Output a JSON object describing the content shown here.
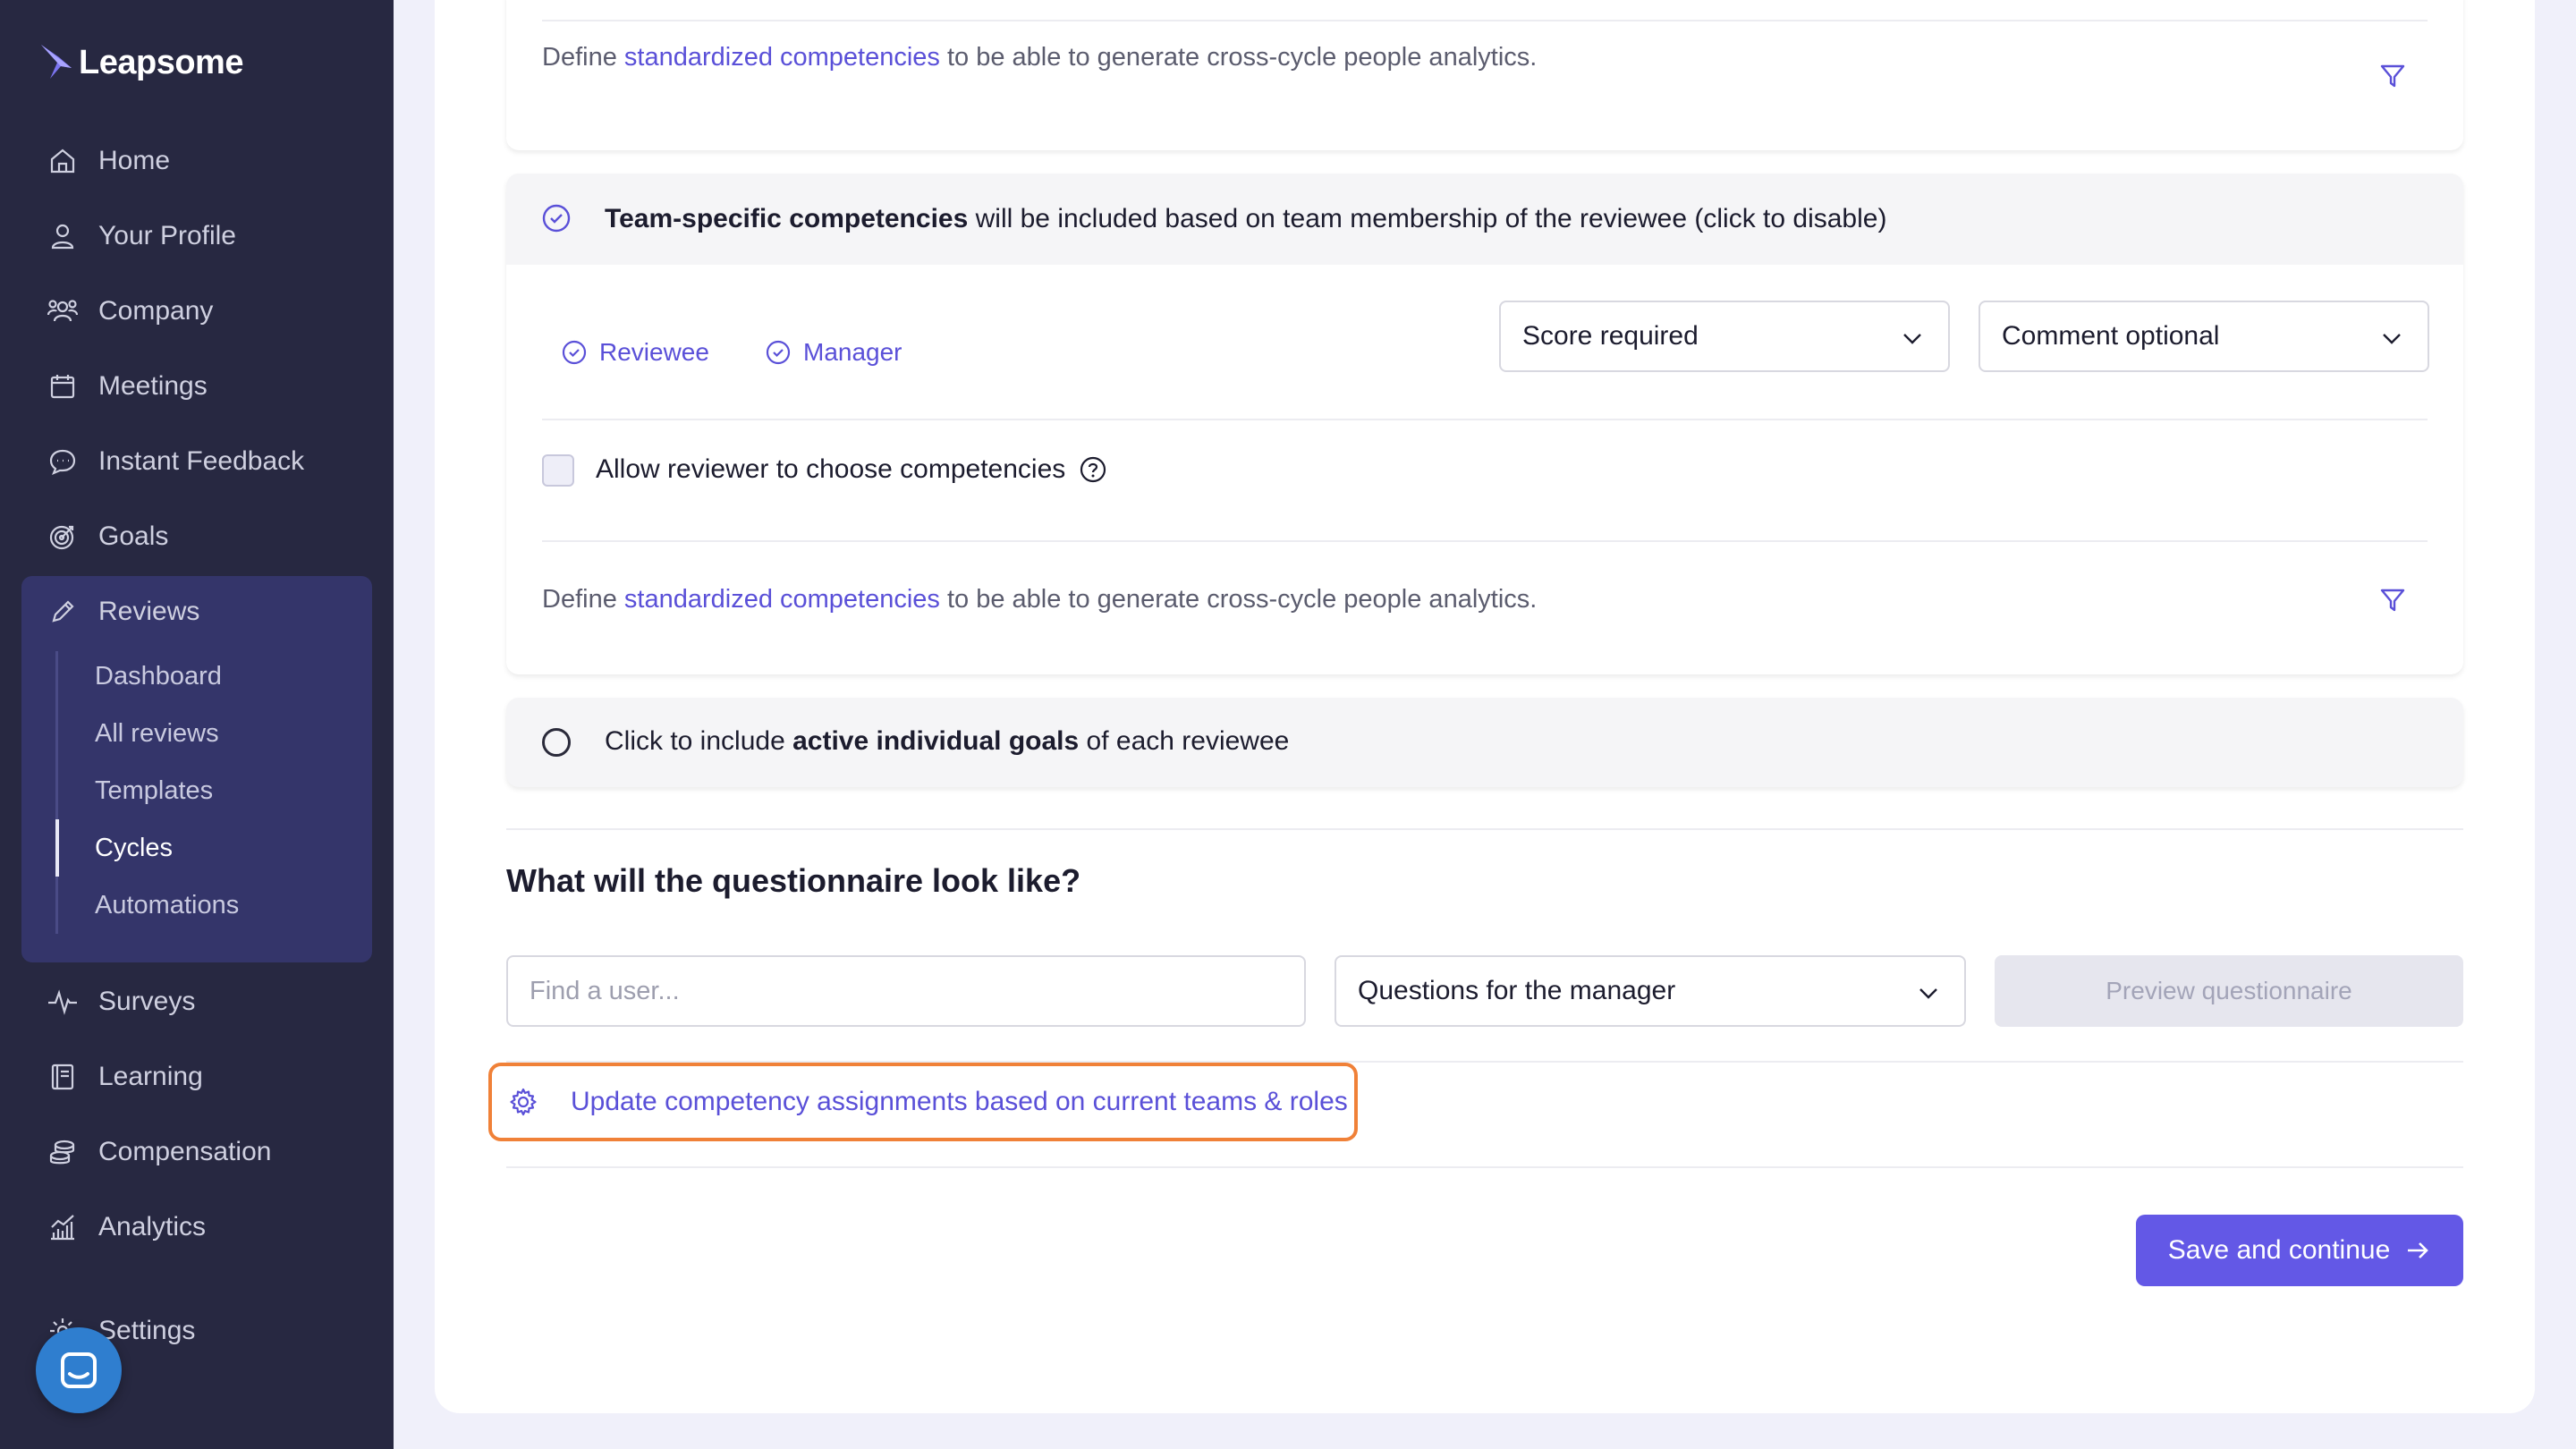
{
  "app": {
    "logo_text": "Leapsome"
  },
  "sidebar": {
    "items": [
      {
        "label": "Home",
        "icon": "home-icon"
      },
      {
        "label": "Your Profile",
        "icon": "user-icon"
      },
      {
        "label": "Company",
        "icon": "people-icon"
      },
      {
        "label": "Meetings",
        "icon": "calendar-icon"
      },
      {
        "label": "Instant Feedback",
        "icon": "chat-bubble-icon"
      },
      {
        "label": "Goals",
        "icon": "target-icon"
      },
      {
        "label": "Reviews",
        "icon": "pencil-icon"
      },
      {
        "label": "Surveys",
        "icon": "pulse-icon"
      },
      {
        "label": "Learning",
        "icon": "book-icon"
      },
      {
        "label": "Compensation",
        "icon": "coins-icon"
      },
      {
        "label": "Analytics",
        "icon": "chart-icon"
      },
      {
        "label": "Settings",
        "icon": "gear-icon"
      }
    ],
    "review_sub_items": [
      {
        "label": "Dashboard",
        "active": false
      },
      {
        "label": "All reviews",
        "active": false
      },
      {
        "label": "Templates",
        "active": false
      },
      {
        "label": "Cycles",
        "active": true
      },
      {
        "label": "Automations",
        "active": false
      }
    ]
  },
  "panel_top": {
    "define_prefix": "Define ",
    "define_link": "standardized competencies",
    "define_suffix": " to be able to generate cross-cycle people analytics."
  },
  "team_panel": {
    "title_bold": "Team-specific competencies",
    "title_rest": " will be included based on team membership of the reviewee (click to disable)",
    "roles": [
      "Reviewee",
      "Manager"
    ],
    "score_select": "Score required",
    "comment_select": "Comment optional",
    "allow_label": "Allow reviewer to choose competencies",
    "define_prefix": "Define ",
    "define_link": "standardized competencies",
    "define_suffix": " to be able to generate cross-cycle people analytics."
  },
  "goals_panel": {
    "prefix": "Click to include ",
    "bold": "active individual goals",
    "suffix": " of each reviewee"
  },
  "questionnaire": {
    "heading": "What will the questionnaire look like?",
    "find_user_placeholder": "Find a user...",
    "questions_select": "Questions for the manager",
    "preview_label": "Preview questionnaire"
  },
  "update_link_label": "Update competency assignments based on current teams & roles",
  "save_label": "Save and continue",
  "colors": {
    "accent": "#6358e6",
    "link": "#5a50d8",
    "highlight": "#f08138",
    "sidebar": "#272841"
  }
}
